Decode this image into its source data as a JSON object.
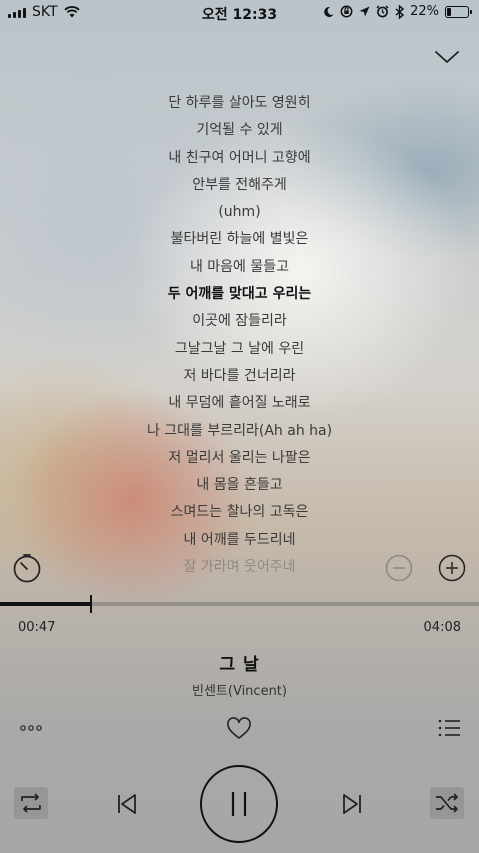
{
  "status_bar": {
    "carrier": "SKT",
    "time": "오전 12:33",
    "battery_text": "22%",
    "battery_level": 0.22,
    "icons": [
      "signal-icon",
      "wifi-icon",
      "moon-icon",
      "rotation-lock-icon",
      "location-icon",
      "alarm-icon",
      "bluetooth-icon",
      "battery-icon"
    ]
  },
  "lyrics": {
    "current_index": 7,
    "lines": [
      "단 하루를 살아도 영원히",
      "기억될 수 있게",
      "내 친구여 어머니 고향에",
      "안부를 전해주게",
      "(uhm)",
      "불타버린 하늘에 별빛은",
      "내 마음에 물들고",
      "두 어깨를 맞대고 우리는",
      "이곳에 잠들리라",
      "그날그날 그 날에 우린",
      "저 바다를 건너리라",
      "내 무덤에 흩어질 노래로",
      "나 그대를 부르리라(Ah ah ha)",
      "저 멀리서 울리는 나팔은",
      "내 몸을 흔들고",
      "스며드는 찰나의 고독은",
      "내 어깨를 두드리네",
      "잘 가라며 웃어주네"
    ]
  },
  "player": {
    "elapsed": "00:47",
    "duration": "04:08",
    "progress": 0.19,
    "title": "그 날",
    "artist": "빈센트(Vincent)",
    "liked": false,
    "repeat_active": true,
    "shuffle_active": true,
    "is_playing": true
  },
  "colors": {
    "text_primary": "#111111",
    "progress_track": "#6e6e6e"
  }
}
